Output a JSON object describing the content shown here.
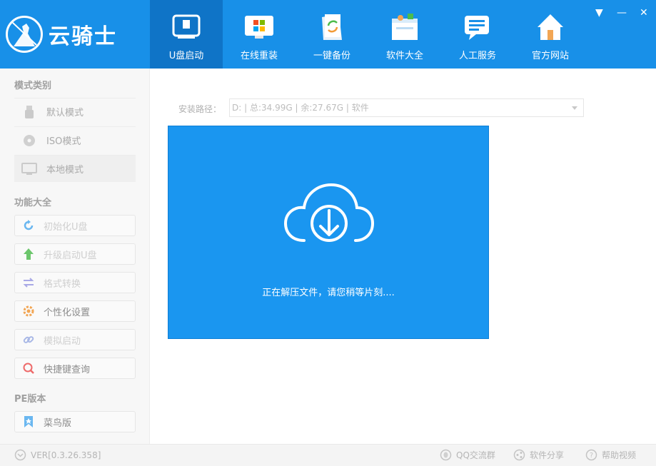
{
  "app": {
    "name": "云骑士"
  },
  "nav": [
    {
      "label": "U盘启动",
      "icon": "usb-drive-icon",
      "active": true
    },
    {
      "label": "在线重装",
      "icon": "windows-monitor-icon",
      "active": false
    },
    {
      "label": "一键备份",
      "icon": "backup-refresh-icon",
      "active": false
    },
    {
      "label": "软件大全",
      "icon": "software-box-icon",
      "active": false
    },
    {
      "label": "人工服务",
      "icon": "chat-bubble-icon",
      "active": false
    },
    {
      "label": "官方网站",
      "icon": "home-icon",
      "active": false
    }
  ],
  "window_controls": {
    "menu": "▼",
    "minimize": "—",
    "close": "✕"
  },
  "sidebar": {
    "mode_title": "模式类别",
    "modes": [
      {
        "label": "默认模式",
        "icon": "usb-stick-icon"
      },
      {
        "label": "ISO模式",
        "icon": "disc-icon"
      },
      {
        "label": "本地模式",
        "icon": "monitor-icon",
        "selected": true
      }
    ],
    "func_title": "功能大全",
    "functions": [
      {
        "label": "初始化U盘",
        "icon": "refresh-icon",
        "icon_color": "#6ab7f0",
        "dim": true
      },
      {
        "label": "升级启动U盘",
        "icon": "arrow-up-icon",
        "icon_color": "#6cc66c",
        "dim": true
      },
      {
        "label": "格式转换",
        "icon": "swap-arrows-icon",
        "icon_color": "#a9a9e6",
        "dim": true
      },
      {
        "label": "个性化设置",
        "icon": "gear-icon",
        "icon_color": "#f2a654",
        "dim": false
      },
      {
        "label": "模拟启动",
        "icon": "link-icon",
        "icon_color": "#a9b8e6",
        "dim": true
      },
      {
        "label": "快捷键查询",
        "icon": "search-icon",
        "icon_color": "#ee6a6a",
        "dim": false
      }
    ],
    "pe_title": "PE版本",
    "pe_items": [
      {
        "label": "菜鸟版",
        "icon": "bookmark-icon",
        "icon_color": "#6ab7f0"
      }
    ]
  },
  "main": {
    "path_label": "安装路径：",
    "path_value": "D: | 总:34.99G | 余:27.67G | 软件",
    "status": "正在解压文件，请您稍等片刻....",
    "accent": "#1a96f0"
  },
  "footer": {
    "version": "VER[0.3.26.358]",
    "qq_group": "QQ交流群",
    "share": "软件分享",
    "help_video": "帮助视频"
  }
}
